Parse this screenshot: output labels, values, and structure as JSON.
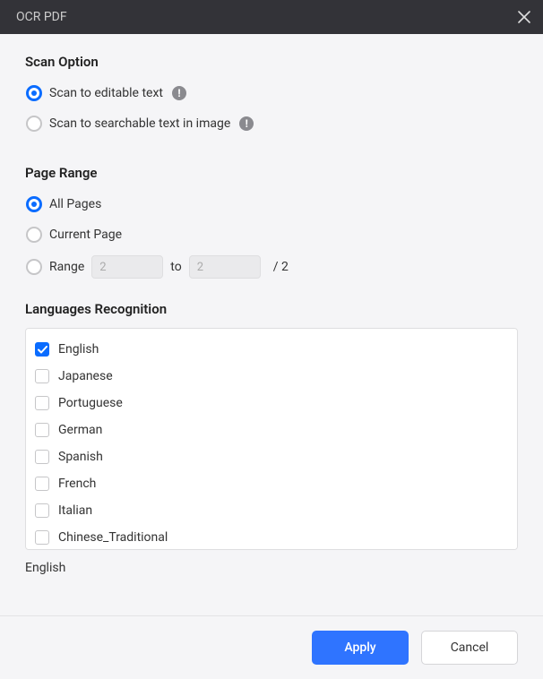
{
  "titlebar": {
    "title": "OCR PDF"
  },
  "scan": {
    "heading": "Scan Option",
    "options": [
      {
        "label": "Scan to editable text",
        "selected": true
      },
      {
        "label": "Scan to searchable text in image",
        "selected": false
      }
    ]
  },
  "pageRange": {
    "heading": "Page Range",
    "allPagesLabel": "All Pages",
    "currentPageLabel": "Current Page",
    "rangeLabel": "Range",
    "rangeFrom": "2",
    "rangeToLabel": "to",
    "rangeTo": "2",
    "totalPagesLabel": "/ 2",
    "selected": "all"
  },
  "languages": {
    "heading": "Languages Recognition",
    "items": [
      {
        "label": "English",
        "checked": true
      },
      {
        "label": "Japanese",
        "checked": false
      },
      {
        "label": "Portuguese",
        "checked": false
      },
      {
        "label": "German",
        "checked": false
      },
      {
        "label": "Spanish",
        "checked": false
      },
      {
        "label": "French",
        "checked": false
      },
      {
        "label": "Italian",
        "checked": false
      },
      {
        "label": "Chinese_Traditional",
        "checked": false
      }
    ],
    "selectedSummary": "English"
  },
  "footer": {
    "applyLabel": "Apply",
    "cancelLabel": "Cancel"
  }
}
